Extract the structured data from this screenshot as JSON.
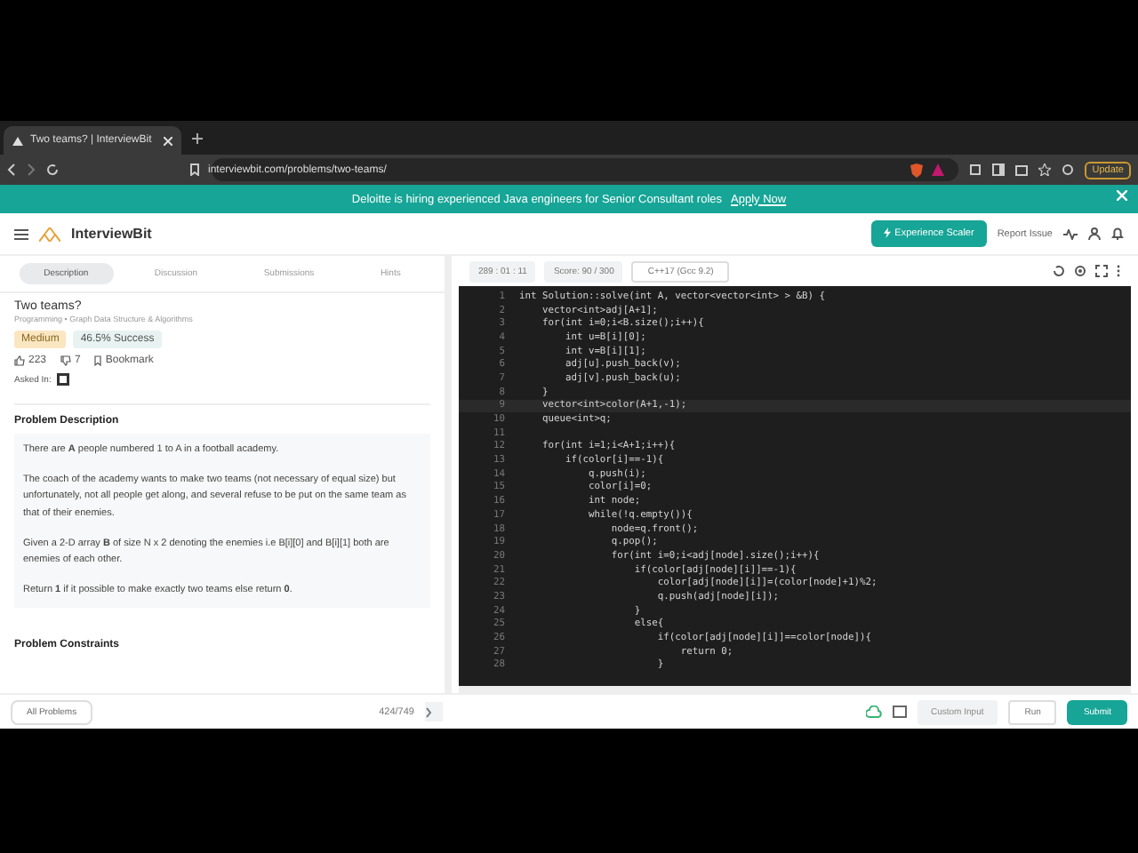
{
  "browser": {
    "tab_title": "Two teams? | InterviewBit",
    "url": "interviewbit.com/problems/two-teams/",
    "update_label": "Update"
  },
  "banner": {
    "text": "Deloitte is hiring experienced Java engineers for Senior Consultant roles",
    "link": "Apply Now"
  },
  "header": {
    "logo": "InterviewBit",
    "experience_button": "Experience Scaler",
    "report_issue": "Report Issue"
  },
  "problem_tabs": [
    {
      "label": "Description",
      "selected": true
    },
    {
      "label": "Discussion",
      "selected": false
    },
    {
      "label": "Submissions",
      "selected": false
    },
    {
      "label": "Hints",
      "selected": false
    }
  ],
  "problem": {
    "title": "Two teams?",
    "breadcrumb": "Programming • Graph Data Structure & Algorithms",
    "difficulty": "Medium",
    "success": "46.5% Success",
    "likes": "223",
    "dislikes": "7",
    "bookmark": "Bookmark",
    "asked_in_label": "Asked In:",
    "section_title": "Problem Description",
    "paragraphs": [
      "There are **A** people numbered 1 to A in a football academy.",
      "The coach of the academy wants to make two teams (not necessary of equal size) but unfortunately, not all people get along, and several refuse to be put on the same team as that of their enemies.",
      "Given a 2-D array **B** of size N x 2 denoting the enemies i.e B[i][0] and B[i][1] both are enemies of each other.",
      "Return **1** if it possible to make exactly two teams else return **0**."
    ],
    "next_section": "Problem Constraints"
  },
  "editor": {
    "timer": "289 : 01 : 11",
    "score": "Score: 90 / 300",
    "language": "C++17 (Gcc 9.2)",
    "lines": [
      {
        "number": "1",
        "code": "int Solution::solve(int A, vector<vector<int> > &B) {",
        "current": false
      },
      {
        "number": "2",
        "code": "    vector<int>adj[A+1];",
        "current": false
      },
      {
        "number": "3",
        "code": "    for(int i=0;i<B.size();i++){",
        "current": false
      },
      {
        "number": "4",
        "code": "        int u=B[i][0];",
        "current": false
      },
      {
        "number": "5",
        "code": "        int v=B[i][1];",
        "current": false
      },
      {
        "number": "6",
        "code": "        adj[u].push_back(v);",
        "current": false
      },
      {
        "number": "7",
        "code": "        adj[v].push_back(u);",
        "current": false
      },
      {
        "number": "8",
        "code": "    }",
        "current": false
      },
      {
        "number": "9",
        "code": "    vector<int>color(A+1,-1);",
        "current": true
      },
      {
        "number": "10",
        "code": "    queue<int>q;",
        "current": false
      },
      {
        "number": "11",
        "current": false
      },
      {
        "number": "12",
        "code": "    for(int i=1;i<A+1;i++){",
        "current": false
      },
      {
        "number": "13",
        "code": "        if(color[i]==-1){",
        "current": false
      },
      {
        "number": "14",
        "code": "            q.push(i);",
        "current": false
      },
      {
        "number": "15",
        "code": "            color[i]=0;",
        "current": false
      },
      {
        "number": "16",
        "code": "            int node;",
        "current": false
      },
      {
        "number": "17",
        "code": "            while(!q.empty()){",
        "current": false
      },
      {
        "number": "18",
        "code": "                node=q.front();",
        "current": false
      },
      {
        "number": "19",
        "code": "                q.pop();",
        "current": false
      },
      {
        "number": "20",
        "code": "                for(int i=0;i<adj[node].size();i++){",
        "current": false
      },
      {
        "number": "21",
        "code": "                    if(color[adj[node][i]]==-1){",
        "current": false
      },
      {
        "number": "22",
        "code": "                        color[adj[node][i]]=(color[node]+1)%2;",
        "current": false
      },
      {
        "number": "23",
        "code": "                        q.push(adj[node][i]);",
        "current": false
      },
      {
        "number": "24",
        "code": "                    }",
        "current": false
      },
      {
        "number": "25",
        "code": "                    else{",
        "current": false
      },
      {
        "number": "26",
        "code": "                        if(color[adj[node][i]]==color[node]){",
        "current": false
      },
      {
        "number": "27",
        "code": "                            return 0;",
        "current": false
      },
      {
        "number": "28",
        "code": "                        }",
        "current": false
      }
    ]
  },
  "footer": {
    "all_problems": "All Problems",
    "counter": "424/749",
    "custom_input": "Custom Input",
    "run": "Run",
    "submit": "Submit"
  }
}
